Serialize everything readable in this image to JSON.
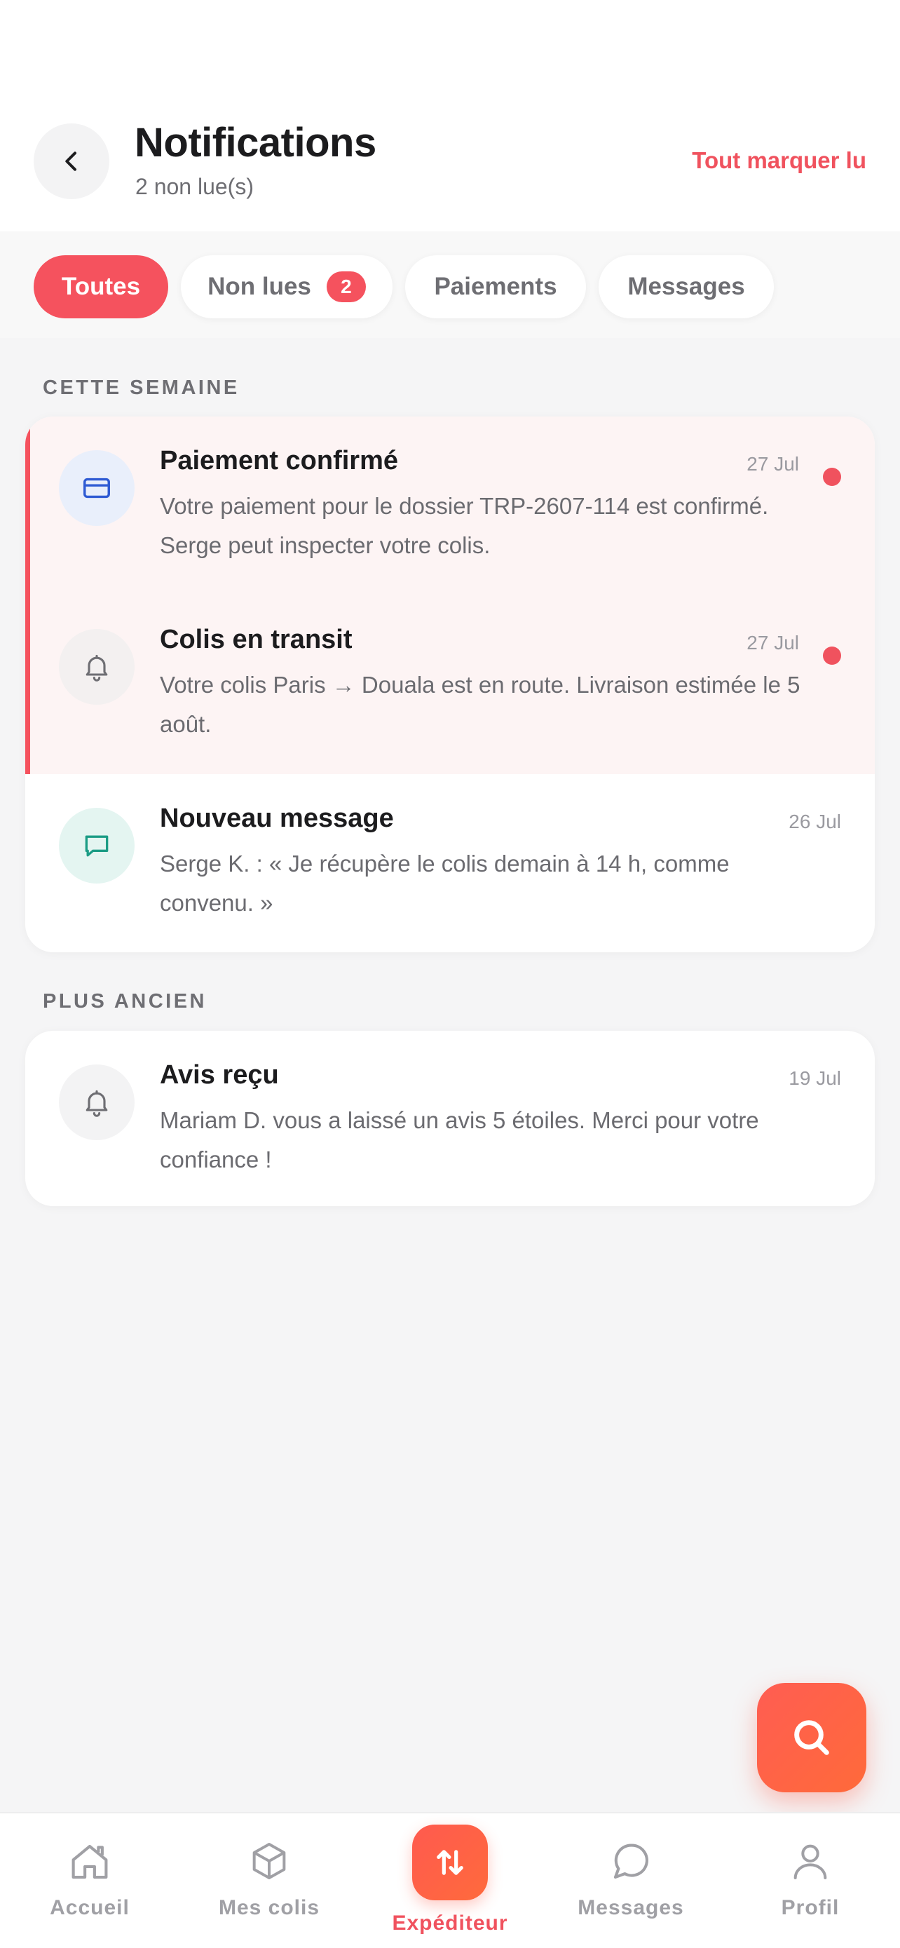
{
  "header": {
    "title": "Notifications",
    "subtitle": "2 non lue(s)",
    "mark_all_label": "Tout marquer lu"
  },
  "filters": [
    {
      "label": "Toutes",
      "active": true
    },
    {
      "label": "Non lues",
      "count": "2"
    },
    {
      "label": "Paiements"
    },
    {
      "label": "Messages"
    }
  ],
  "sections": {
    "this_week": "CETTE SEMAINE",
    "older": "PLUS ANCIEN"
  },
  "notifications_this_week": [
    {
      "title": "Paiement confirmé",
      "date": "27 Jul",
      "body": "Votre paiement pour le dossier TRP-2607-114 est confirmé. Serge peut inspecter votre colis.",
      "icon": "credit-card-icon",
      "unread": true
    },
    {
      "title": "Colis en transit",
      "date": "27 Jul",
      "body": "Votre colis Paris → Douala est en route. Livraison estimée le 5 août.",
      "icon": "bell-icon",
      "unread": true
    },
    {
      "title": "Nouveau message",
      "date": "26 Jul",
      "body": "Serge K. : « Je récupère le colis demain à 14 h, comme convenu. »",
      "icon": "chat-icon",
      "unread": false
    }
  ],
  "notifications_older": [
    {
      "title": "Avis reçu",
      "date": "19 Jul",
      "body": "Mariam D. vous a laissé un avis 5 étoiles. Merci pour votre confiance !",
      "icon": "bell-icon",
      "unread": false
    }
  ],
  "tabbar": [
    {
      "label": "Accueil",
      "icon": "home-icon"
    },
    {
      "label": "Mes colis",
      "icon": "box-icon"
    },
    {
      "label": "Expéditeur",
      "icon": "swap-arrows-icon",
      "active": true
    },
    {
      "label": "Messages",
      "icon": "chat-bubble-icon"
    },
    {
      "label": "Profil",
      "icon": "user-icon"
    }
  ],
  "colors": {
    "accent": "#f5525e",
    "unread_bg": "#fdf4f4",
    "text": "#1c1c1e",
    "muted": "#6e6e73"
  }
}
